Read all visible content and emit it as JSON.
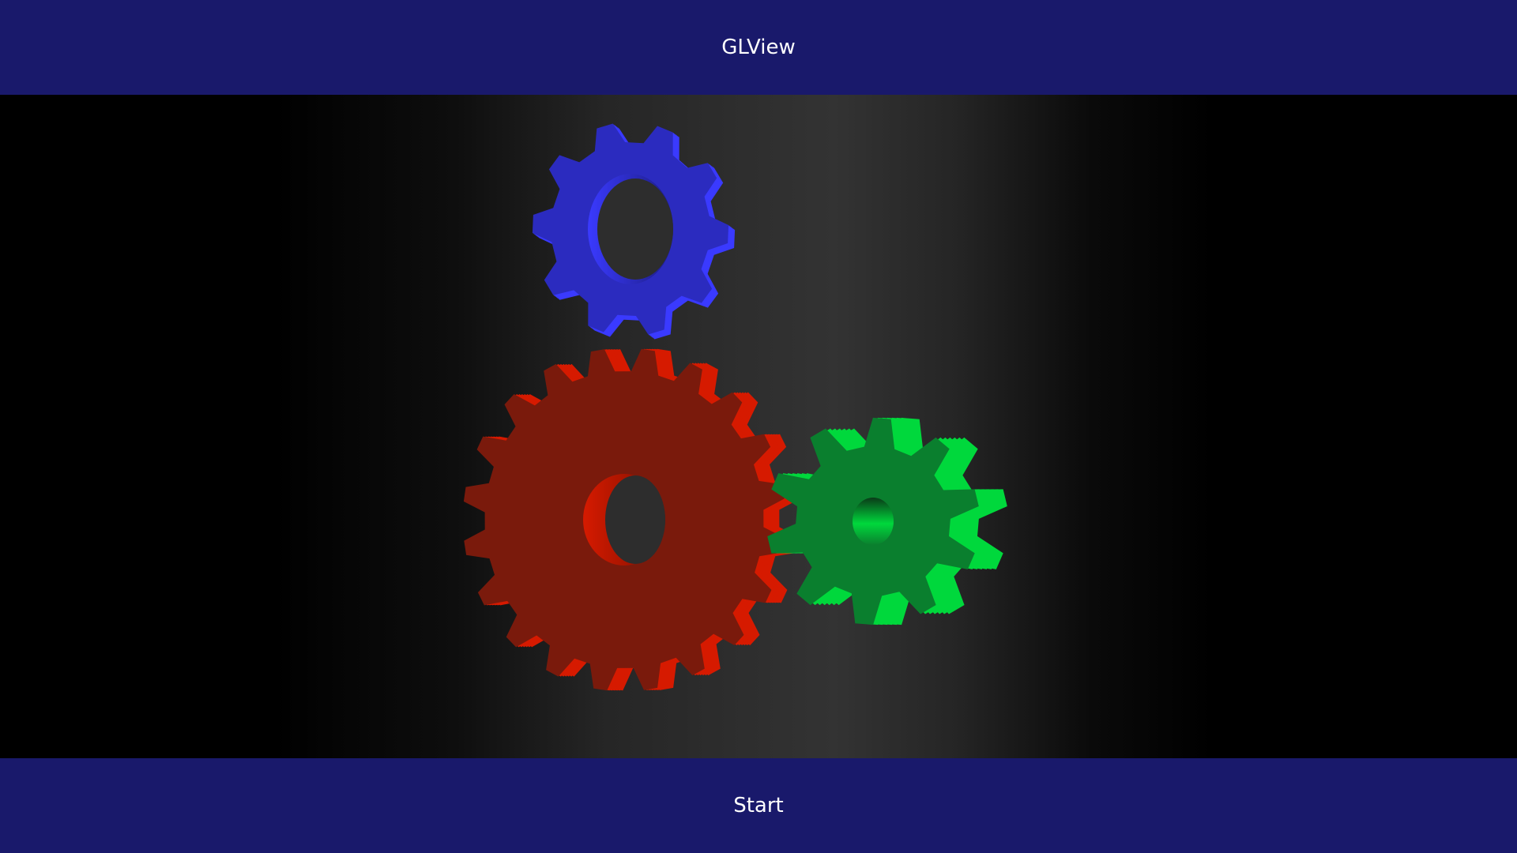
{
  "header": {
    "title": "GLView"
  },
  "footer": {
    "button_label": "Start"
  },
  "colors": {
    "bar_background": "#19196b",
    "bar_text": "#ffffff",
    "red_gear": "#7a1a0c",
    "red_gear_highlight": "#d61a00",
    "green_gear": "#0a7f2e",
    "green_gear_highlight": "#00d83c",
    "blue_gear": "#2b2bbf",
    "blue_gear_highlight": "#3a3aff"
  },
  "scene": {
    "gears": [
      {
        "name": "red-gear",
        "teeth": 20
      },
      {
        "name": "green-gear",
        "teeth": 10
      },
      {
        "name": "blue-gear",
        "teeth": 10
      }
    ]
  }
}
